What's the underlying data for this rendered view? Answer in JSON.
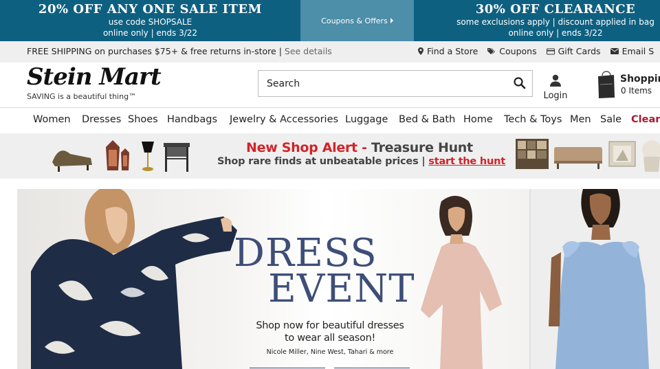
{
  "promo": {
    "left_title": "20% OFF ANY ONE SALE ITEM",
    "left_line1": "use code SHOPSALE",
    "left_line2": "online only | ends 3/22",
    "middle_label": "Coupons & Offers",
    "right_title": "30% OFF CLEARANCE",
    "right_line1": "some exclusions apply | discount applied in bag",
    "right_line2": "online only | ends 3/22"
  },
  "utility": {
    "shipping_text": "FREE SHIPPING on purchases $75+ & free returns in-store | ",
    "details_link": "See details",
    "links": [
      "Find a Store",
      "Coupons",
      "Gift Cards",
      "Email S"
    ]
  },
  "header": {
    "logo_text": "Stein Mart",
    "tagline": "SAVING is a beautiful thing™",
    "search_placeholder": "Search",
    "login_label": "Login",
    "cart_title": "Shoppin",
    "cart_items": "0 Items"
  },
  "nav": {
    "items": [
      "Women",
      "Dresses",
      "Shoes",
      "Handbags",
      "Jewelry & Accessories",
      "Luggage",
      "Bed & Bath",
      "Home",
      "Tech & Toys",
      "Men",
      "Sale",
      "Cleara"
    ]
  },
  "banner": {
    "title_red": "New Shop Alert",
    "title_sep": " - ",
    "title_gray": "Treasure Hunt",
    "subtitle": "Shop rare finds at unbeatable prices | ",
    "cta": "start the hunt"
  },
  "hero": {
    "title_line1": "DRESS",
    "title_line2": "EVENT",
    "sub_line1": "Shop now for beautiful dresses",
    "sub_line2": "to wear all season!",
    "brands": "Nicole Miller, Nine West, Tahari & more"
  },
  "colors": {
    "promo_bg": "#0e6080",
    "promo_mid_bg": "#4d8ea9",
    "accent_red": "#d2232a",
    "hero_title": "#3d4e78"
  }
}
